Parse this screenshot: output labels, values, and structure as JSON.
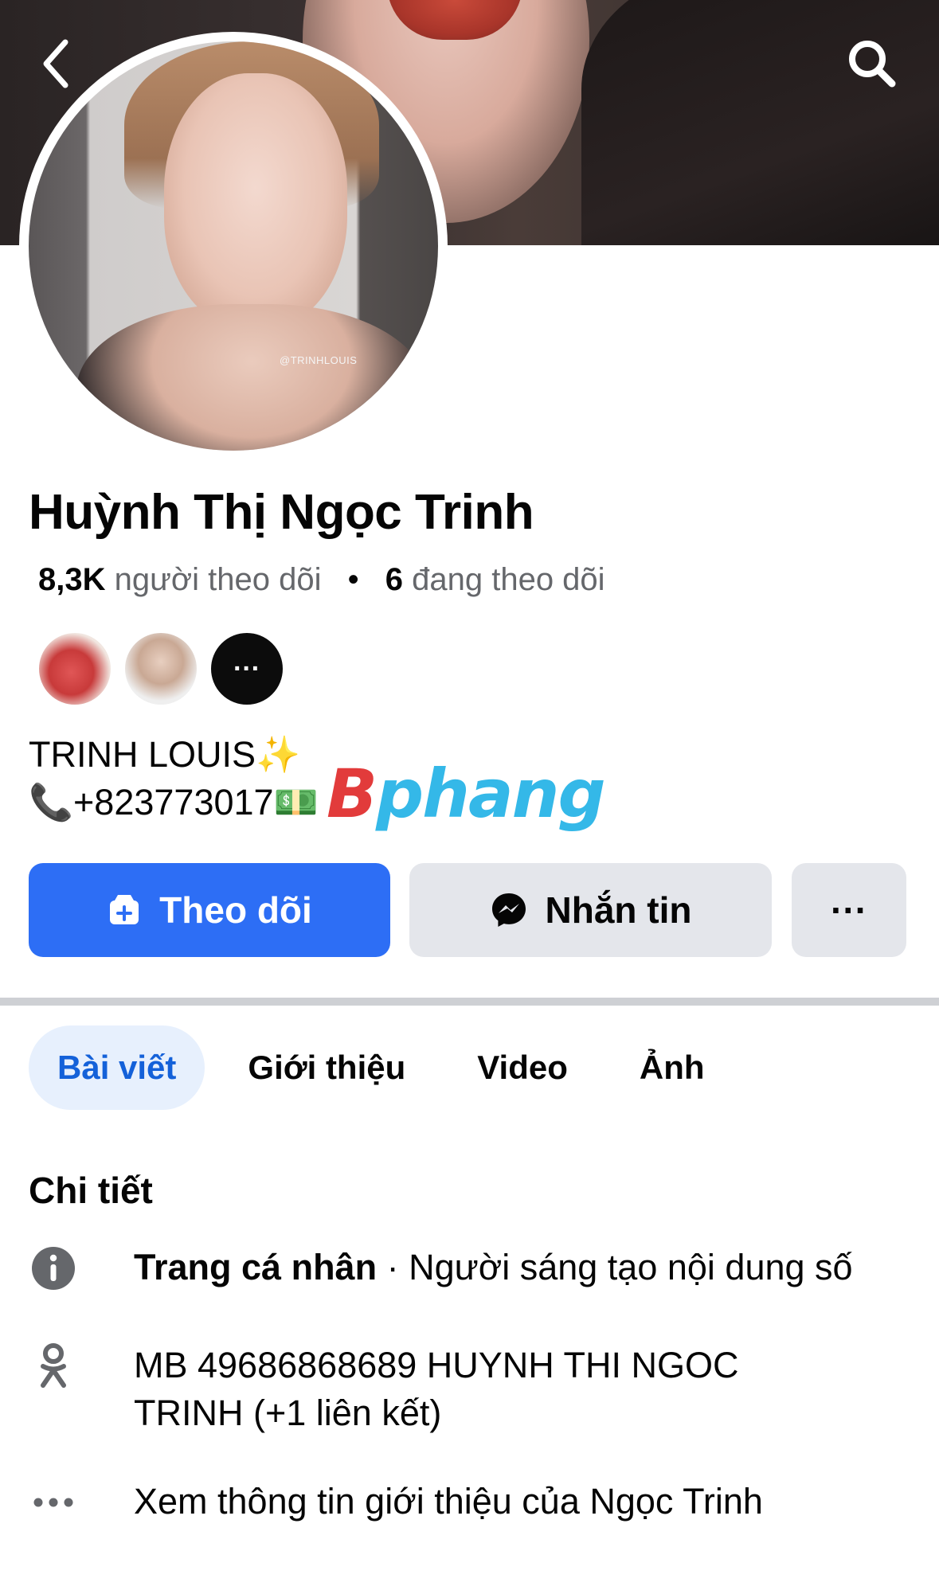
{
  "header": {
    "back_icon": "chevron-left-icon",
    "search_icon": "search-icon",
    "avatar_watermark": "@TRINHLOUIS"
  },
  "profile": {
    "name": "Huỳnh Thị Ngọc Trinh",
    "followers_count": "8,3K",
    "followers_label": "người theo dõi",
    "separator": "•",
    "following_count": "6",
    "following_label": "đang theo dõi",
    "friends_more_label": "···",
    "bio_line1": "TRINH LOUIS✨",
    "bio_line2": "📞+823773017💵"
  },
  "watermark": {
    "text_part1": "B",
    "text_part2": "phang",
    "color_blue": "#2d8fe0",
    "color_red": "#e23b3b"
  },
  "actions": {
    "follow_label": "Theo dõi",
    "message_label": "Nhắn tin",
    "more_label": "···"
  },
  "tabs": [
    {
      "label": "Bài viết",
      "active": true
    },
    {
      "label": "Giới thiệu",
      "active": false
    },
    {
      "label": "Video",
      "active": false
    },
    {
      "label": "Ảnh",
      "active": false
    }
  ],
  "details": {
    "title": "Chi tiết",
    "page_type_bold": "Trang cá nhân",
    "page_type_rest": " · Người sáng tạo nội dung số",
    "link_text": "MB 49686868689 HUYNH THI NGOC TRINH (+1 liên kết)",
    "more_text": "Xem thông tin giới thiệu của Ngọc Trinh"
  },
  "colors": {
    "accent": "#2d6ef5",
    "tab_active_bg": "#e7f0fd",
    "tab_active_text": "#1461d9",
    "secondary_button": "#e4e6eb"
  }
}
